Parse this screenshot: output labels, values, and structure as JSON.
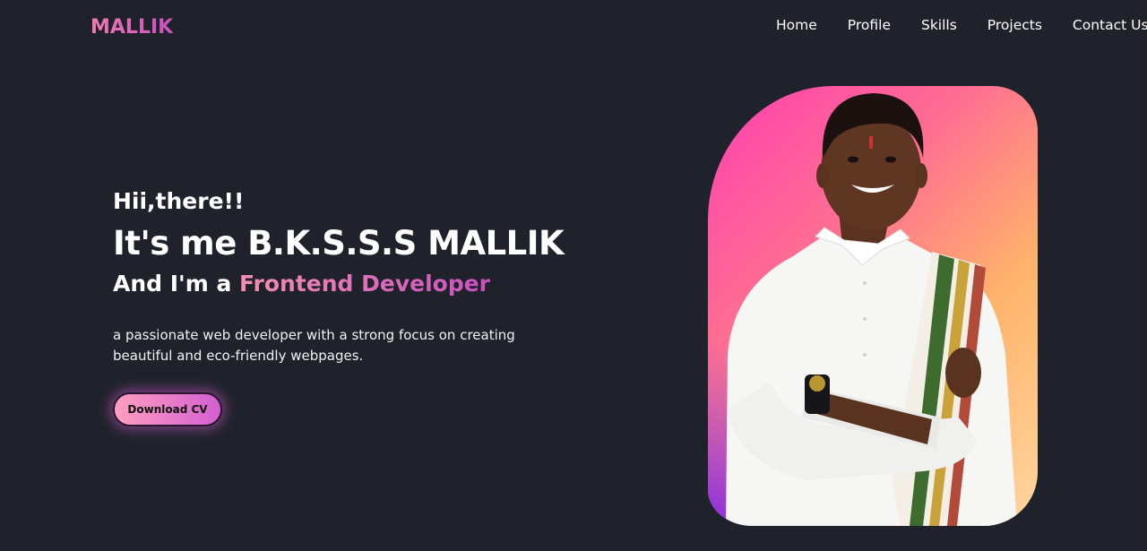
{
  "header": {
    "logo": "MALLIK",
    "nav": [
      "Home",
      "Profile",
      "Skills",
      "Projects",
      "Contact Us"
    ]
  },
  "hero": {
    "greeting": "Hii,there!!",
    "name": "It's me B.K.S.S.S MALLIK",
    "role_prefix": "And I'm a ",
    "role_accent": "Frontend Developer",
    "description": "a passionate web developer with a strong focus on creating beautiful and eco-friendly webpages.",
    "cta_label": "Download CV"
  },
  "colors": {
    "background": "#1f222b",
    "accent_pink": "#f48fb1",
    "accent_purple": "#c850c0"
  }
}
